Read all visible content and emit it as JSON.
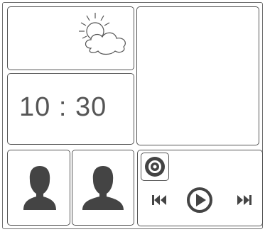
{
  "clock": {
    "time": "10 : 30"
  },
  "weather": {
    "icon": "partly-cloudy-icon"
  },
  "contacts": [
    {
      "icon": "person-avatar-icon"
    },
    {
      "icon": "person-avatar-icon"
    }
  ],
  "media": {
    "record_icon": "record-icon",
    "prev_icon": "skip-previous-icon",
    "play_icon": "play-icon",
    "next_icon": "skip-next-icon"
  },
  "colors": {
    "stroke": "#555555",
    "fill_dark": "#444444",
    "background": "#ffffff"
  }
}
